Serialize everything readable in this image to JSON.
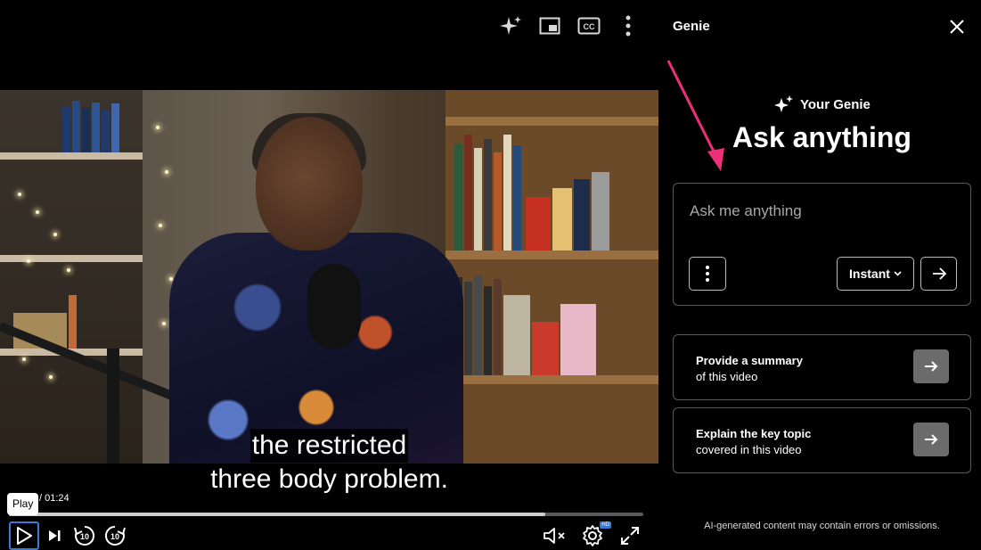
{
  "player": {
    "top_icons": [
      "sparkle-icon",
      "picture-in-picture-icon",
      "closed-captions-icon",
      "more-vertical-icon"
    ],
    "cc_label": "CC",
    "captions": [
      "the restricted",
      "three body problem."
    ],
    "time_display": "/ 01:24",
    "tooltip": "Play",
    "progress_played": 0.845,
    "controls": {
      "play": "play-icon",
      "next": "skip-next-icon",
      "rewind": "rewind-10-icon",
      "forward": "forward-10-icon",
      "seek_label": "10",
      "mute": "muted-speaker-icon",
      "settings": "settings-gear-icon",
      "settings_badge": "HD",
      "fullscreen": "fullscreen-icon"
    }
  },
  "genie": {
    "title": "Genie",
    "subtitle": "Your Genie",
    "headline": "Ask anything",
    "input_placeholder": "Ask me anything",
    "mode_label": "Instant",
    "suggestions": [
      {
        "line1": "Provide a summary",
        "line2": "of this video"
      },
      {
        "line1": "Explain the key topic",
        "line2": "covered in this video"
      }
    ],
    "disclaimer": "AI-generated content may contain errors or omissions.",
    "colors": {
      "annotation_arrow": "#ee2f7a",
      "button_gray": "#6b6b6b",
      "focus": "#3a78d6"
    }
  }
}
